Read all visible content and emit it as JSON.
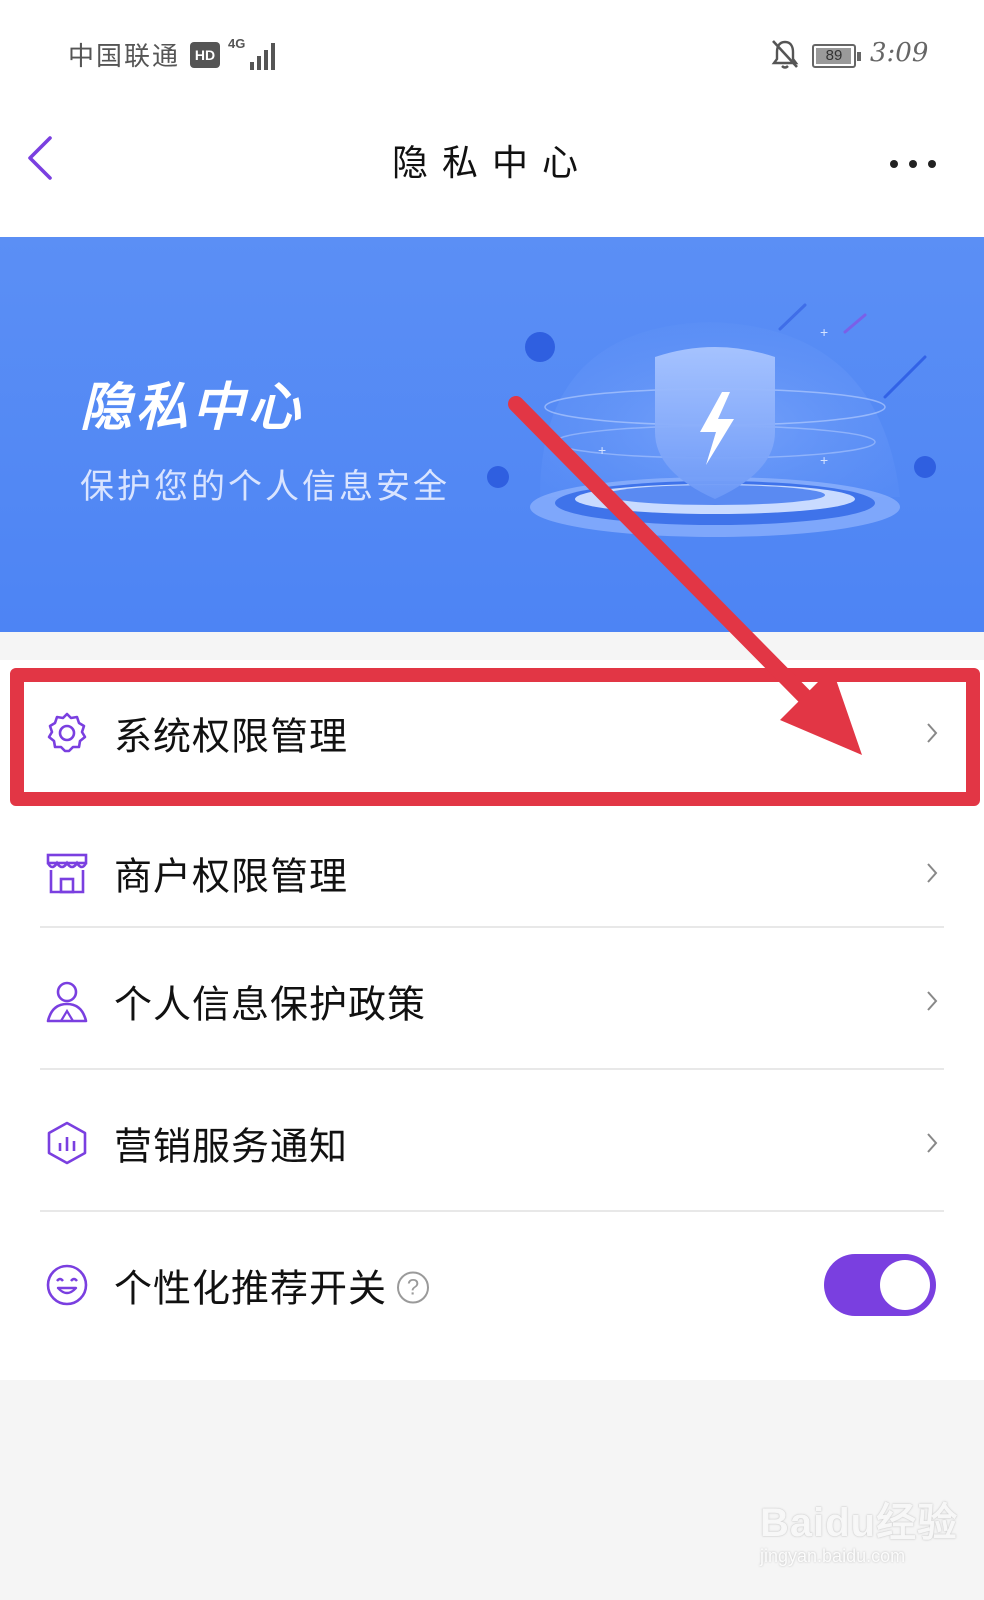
{
  "status_bar": {
    "carrier": "中国联通",
    "hd_badge": "HD",
    "network": "4G",
    "battery_level": "89",
    "time": "3:09"
  },
  "title_bar": {
    "title": "隐私中心"
  },
  "banner": {
    "title": "隐私中心",
    "subtitle": "保护您的个人信息安全"
  },
  "menu": {
    "items": [
      {
        "label": "系统权限管理",
        "icon": "gear-icon"
      },
      {
        "label": "商户权限管理",
        "icon": "store-icon"
      },
      {
        "label": "个人信息保护政策",
        "icon": "user-icon"
      },
      {
        "label": "营销服务通知",
        "icon": "chart-hexagon-icon"
      },
      {
        "label": "个性化推荐开关",
        "icon": "smile-icon",
        "toggle_on": true
      }
    ],
    "help_glyph": "?"
  },
  "watermark": {
    "text": "Baidu经验",
    "url": "jingyan.baidu.com"
  },
  "colors": {
    "accent": "#7a3fe0",
    "banner": "#4d84f4",
    "annotation": "#e23645"
  }
}
